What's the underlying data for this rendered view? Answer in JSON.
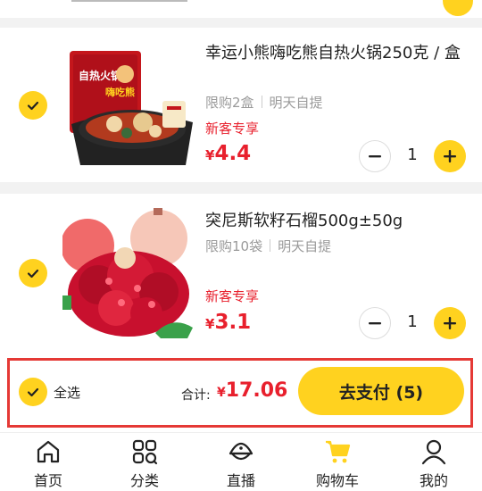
{
  "colors": {
    "accent": "#ffd21f",
    "price_red": "#e8202d",
    "highlight_frame": "#e53935"
  },
  "cart": {
    "items": [
      {
        "title": "幸运小熊嗨吃熊自热火锅250克 / 盒",
        "limit": "限购2盒",
        "delivery": "明天自提",
        "promo": "新客专享",
        "currency": "¥",
        "price": "4.4",
        "quantity": "1",
        "image_icon": "hotpot-box-image",
        "image_text_1": "自热火锅",
        "image_text_2": "嗨吃熊"
      },
      {
        "title": "突尼斯软籽石榴500g±50g",
        "limit": "限购10袋",
        "delivery": "明天自提",
        "promo": "新客专享",
        "currency": "¥",
        "price": "3.1",
        "quantity": "1",
        "image_icon": "pomegranate-image"
      }
    ]
  },
  "checkout": {
    "select_all_label": "全选",
    "total_label": "合计:",
    "currency": "¥",
    "total_amount": "17.06",
    "pay_button_label": "去支付 (5)"
  },
  "tabbar": {
    "tabs": [
      {
        "label": "首页",
        "icon": "home-icon"
      },
      {
        "label": "分类",
        "icon": "category-icon"
      },
      {
        "label": "直播",
        "icon": "live-icon"
      },
      {
        "label": "购物车",
        "icon": "cart-icon"
      },
      {
        "label": "我的",
        "icon": "profile-icon"
      }
    ]
  }
}
